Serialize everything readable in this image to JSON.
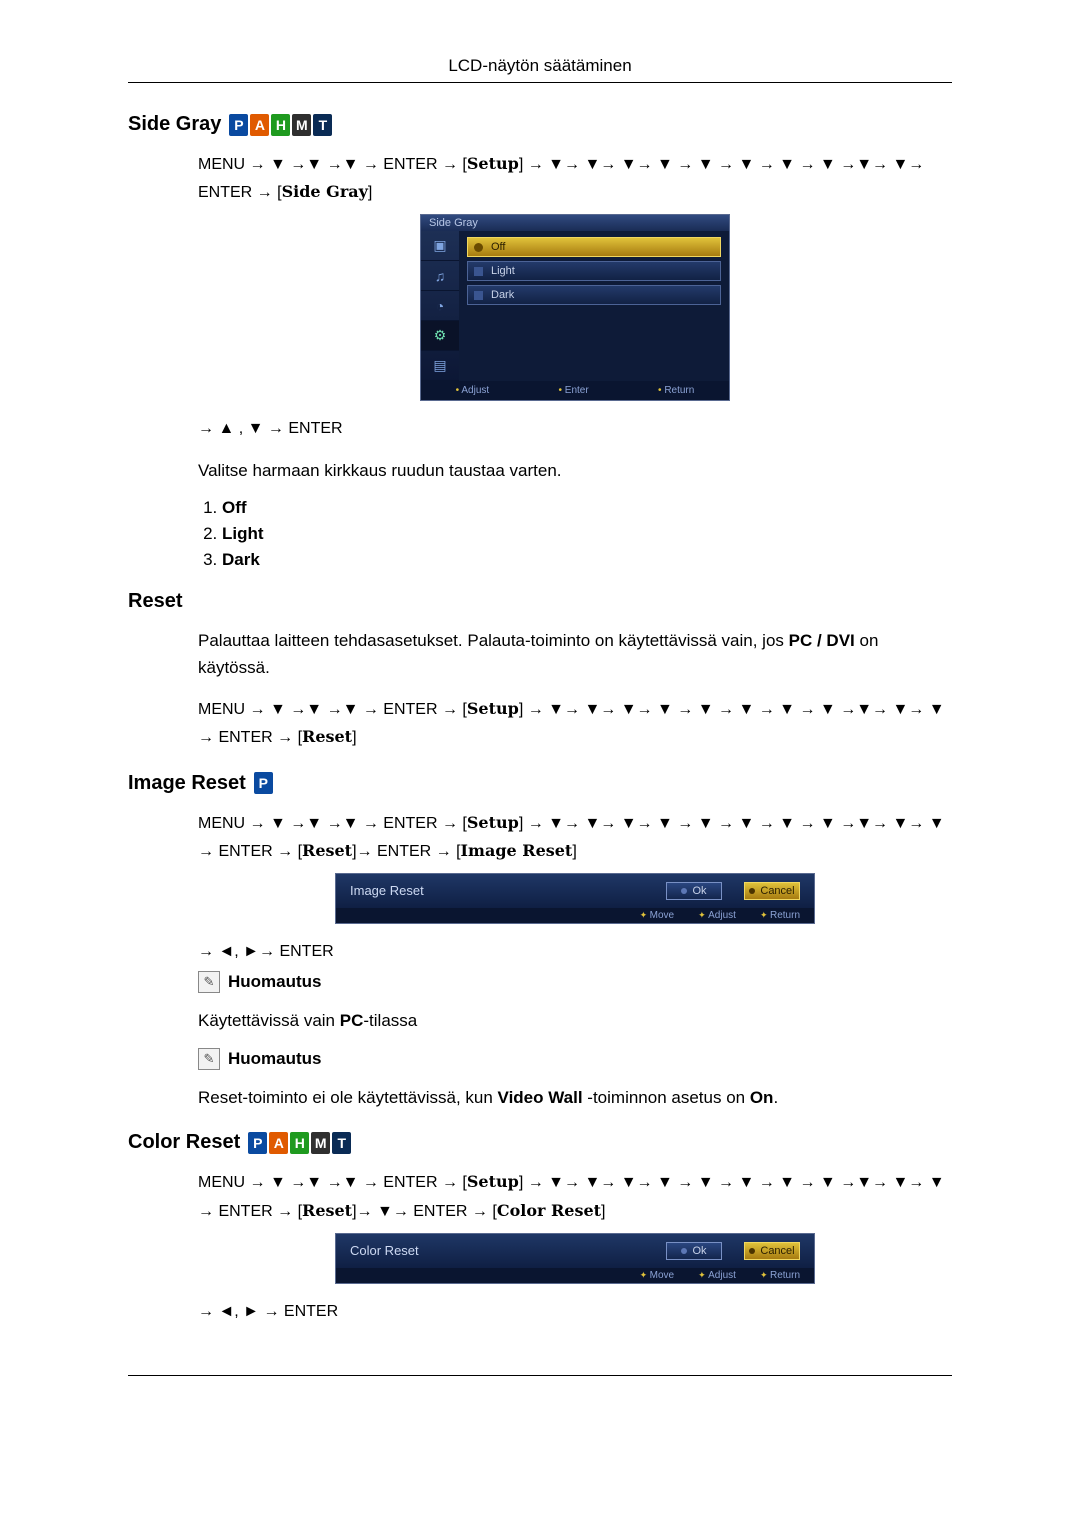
{
  "header": {
    "title": "LCD-näytön säätäminen"
  },
  "badges": [
    "P",
    "A",
    "H",
    "M",
    "T"
  ],
  "sections": {
    "sidegray": {
      "heading": "Side Gray",
      "nav1_a": "MENU → ▼ →▼ →▼ → ENTER → ",
      "nav1_tag_setup": "Setup",
      "nav1_b": " → ▼→ ▼→ ▼→ ▼ → ▼ → ▼ → ▼ → ▼ →▼→ ▼→ ENTER → ",
      "nav1_tag_side": "Side Gray",
      "osd": {
        "title": "Side Gray",
        "opts": [
          "Off",
          "Light",
          "Dark"
        ],
        "footer": [
          "Adjust",
          "Enter",
          "Return"
        ]
      },
      "nav2": "→ ▲ , ▼ → ENTER",
      "desc": "Valitse harmaan kirkkaus ruudun taustaa varten.",
      "options": [
        "Off",
        "Light",
        "Dark"
      ]
    },
    "reset": {
      "heading": "Reset",
      "desc_a": "Palauttaa laitteen tehdasasetukset. Palauta-toiminto on käytettävissä vain, jos ",
      "desc_b": "PC / DVI",
      "desc_c": " on käytössä.",
      "nav_a": "MENU → ▼ →▼ →▼ → ENTER → ",
      "nav_tag_setup": "Setup",
      "nav_b": " → ▼→ ▼→ ▼→ ▼ → ▼ → ▼ → ▼ → ▼ →▼→ ▼→ ▼ → ENTER → ",
      "nav_tag_reset": "Reset"
    },
    "imagereset": {
      "heading": "Image Reset",
      "nav_a": "MENU → ▼ →▼ →▼ → ENTER → ",
      "nav_tag_setup": "Setup",
      "nav_b": " → ▼→ ▼→ ▼→ ▼ → ▼ → ▼ → ▼ → ▼ →▼→ ▼→ ▼ → ENTER → ",
      "nav_tag_reset": "Reset",
      "nav_c": "→ ENTER → ",
      "nav_tag_image": "Image Reset",
      "osd": {
        "label": "Image Reset",
        "ok": "Ok",
        "cancel": "Cancel",
        "footer": [
          "Move",
          "Adjust",
          "Return"
        ]
      },
      "nav2": "→ ◄, ►→ ENTER",
      "note_label": "Huomautus",
      "note1_a": "Käytettävissä vain ",
      "note1_b": "PC",
      "note1_c": "-tilassa",
      "note2_a": "Reset-toiminto ei ole käytettävissä, kun ",
      "note2_b": "Video Wall",
      "note2_c": " -toiminnon asetus on ",
      "note2_d": "On",
      "note2_e": "."
    },
    "colorreset": {
      "heading": "Color Reset",
      "nav_a": "MENU → ▼ →▼ →▼ → ENTER → ",
      "nav_tag_setup": "Setup",
      "nav_b": " → ▼→ ▼→ ▼→ ▼ → ▼ → ▼ → ▼ → ▼ →▼→ ▼→ ▼ → ENTER → ",
      "nav_tag_reset": "Reset",
      "nav_c": "→ ▼→ ENTER → ",
      "nav_tag_color": "Color Reset",
      "osd": {
        "label": "Color Reset",
        "ok": "Ok",
        "cancel": "Cancel",
        "footer": [
          "Move",
          "Adjust",
          "Return"
        ]
      },
      "nav2": "→ ◄, ► → ENTER"
    }
  }
}
